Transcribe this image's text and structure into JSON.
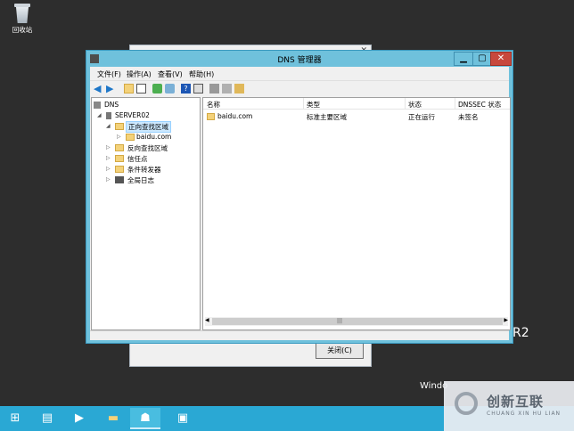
{
  "desktop": {
    "recycle_bin_label": "回收站",
    "behind_text": "R2",
    "windows_partial": "Windo"
  },
  "back_dialog": {
    "close_label": "关闭(C)"
  },
  "window": {
    "title": "DNS 管理器",
    "menu": [
      "文件(F)",
      "操作(A)",
      "查看(V)",
      "帮助(H)"
    ]
  },
  "tree": {
    "root": "DNS",
    "server": "SERVER02",
    "forward_zone": "正向查找区域",
    "forward_child": "baidu.com",
    "reverse_zone": "反向查找区域",
    "trust_points": "信任点",
    "conditional_forwarders": "条件转发器",
    "global_logs": "全局日志"
  },
  "list": {
    "columns": [
      "名称",
      "类型",
      "状态",
      "DNSSEC 状态"
    ],
    "rows": [
      [
        "baidu.com",
        "标准主要区域",
        "正在运行",
        "未签名"
      ]
    ]
  },
  "watermark": {
    "cn": "创新互联",
    "en": "CHUANG XIN HU LIAN"
  },
  "colors": {
    "window_frame": "#6fc1dc",
    "taskbar": "#2aa8d4",
    "close_button": "#c7483d"
  }
}
